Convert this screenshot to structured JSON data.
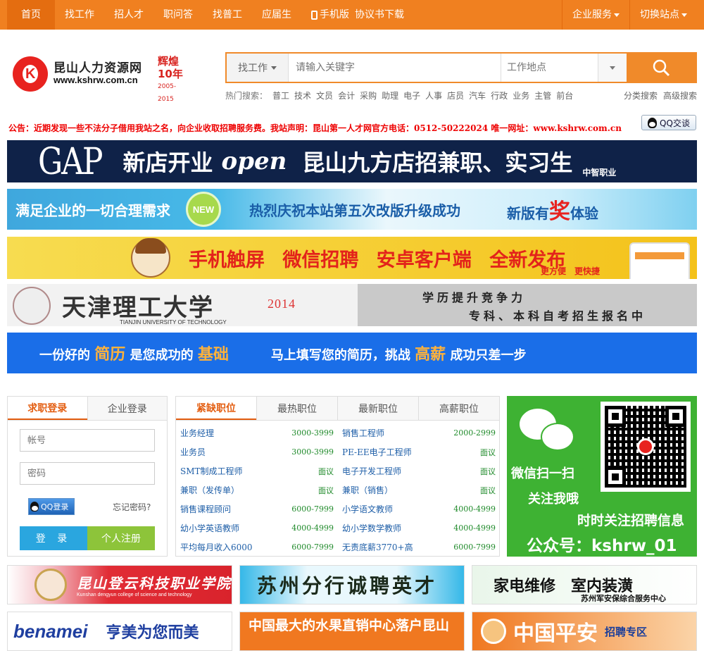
{
  "topnav": {
    "items": [
      "首页",
      "找工作",
      "招人才",
      "职问答",
      "找普工",
      "应届生"
    ],
    "mobile_label": "手机版",
    "agreement_label": "协议书下载",
    "enterprise_label": "企业服务",
    "switch_site_label": "切换站点"
  },
  "logo": {
    "name": "昆山人力资源网",
    "url": "www.kshrw.com.cn",
    "anniv_1": "辉煌",
    "anniv_2": "10年",
    "anniv_years": "2005-2015"
  },
  "search": {
    "type_label": "找工作",
    "keyword_placeholder": "请输入关键字",
    "location_placeholder": "工作地点",
    "hot_label": "热门搜索：",
    "hot_terms": [
      "普工",
      "技术",
      "文员",
      "会计",
      "采购",
      "助理",
      "电子",
      "人事",
      "店员",
      "汽车",
      "行政",
      "业务",
      "主管",
      "前台"
    ],
    "category_search": "分类搜索",
    "advanced_search": "高级搜索"
  },
  "notice": "公告：近期发现一些不法分子借用我站之名，向企业收取招聘服务费。我站声明：昆山第一人才网官方电话：0512-50222024 唯一网址：www.kshrw.com.cn",
  "qq_chat_label": "QQ交谈",
  "banners": {
    "b1": {
      "brand": "GAP",
      "t1": "新店开业",
      "t2": "open",
      "t3": "昆山九方店招兼职、实习生",
      "t4": "中智职业"
    },
    "b2": {
      "t1": "满足企业的一切合理需求",
      "new": "NEW",
      "t2": "热烈庆祝本站第五次改版升级成功",
      "t3a": "新版有",
      "t3b": "奖",
      "t3c": "体验"
    },
    "b3": {
      "t": "手机触屏 微信招聘 安卓客户端 全新发布",
      "sub": "更方便　更快捷"
    },
    "b4": {
      "name": "天津理工大学",
      "en": "TIANJIN UNIVERSITY OF TECHNOLOGY",
      "year": "2014",
      "r1": "学历提升竞争力",
      "r2": "专科、本科自考招生报名中"
    },
    "b5": {
      "t1a": "一份好的",
      "t1b": "简历",
      "t1c": "是您成功的",
      "t1d": "基础",
      "t2a": "马上填写您的简历，挑战",
      "t2b": "高薪",
      "t2c": "成功只差一步"
    }
  },
  "login": {
    "tab_job": "求职登录",
    "tab_company": "企业登录",
    "username_placeholder": "帐号",
    "password_placeholder": "密码",
    "qq_login": "QQ登录",
    "forgot": "忘记密码?",
    "login_btn": "登 录",
    "register_btn": "个人注册"
  },
  "jobs": {
    "tabs": [
      "紧缺职位",
      "最热职位",
      "最新职位",
      "高薪职位"
    ],
    "rows": [
      {
        "title": "业务经理",
        "salary": "3000-3999"
      },
      {
        "title": "销售工程师",
        "salary": "2000-2999"
      },
      {
        "title": "业务员",
        "salary": "3000-3999"
      },
      {
        "title": "PE-EE电子工程师",
        "salary": "面议"
      },
      {
        "title": "SMT制成工程师",
        "salary": "面议"
      },
      {
        "title": "电子开发工程师",
        "salary": "面议"
      },
      {
        "title": "兼职（发传单）",
        "salary": "面议"
      },
      {
        "title": "兼职（销售）",
        "salary": "面议"
      },
      {
        "title": "销售课程顾问",
        "salary": "6000-7999"
      },
      {
        "title": "小学语文教师",
        "salary": "4000-4999"
      },
      {
        "title": "幼小学英语教师",
        "salary": "4000-4999"
      },
      {
        "title": "幼小学数学教师",
        "salary": "4000-4999"
      },
      {
        "title": "平均每月收入6000",
        "salary": "6000-7999"
      },
      {
        "title": "无责底薪3770+高",
        "salary": "6000-7999"
      }
    ]
  },
  "wechat": {
    "l1": "微信扫一扫",
    "l2": "关注我哦",
    "l3": "时时关注招聘信息",
    "l4": "公众号：kshrw_01"
  },
  "ads": {
    "a1": "昆山登云科技职业学院",
    "a1_en": "Kunshan dengyun college of science and technology",
    "a2": "苏州分行诚聘英才",
    "a3": "家电维修　室内装潢",
    "a3_sub": "苏州军安保综合服务中心",
    "a4_logo": "benamei",
    "a4_t": "亨美为您而美",
    "a5": "中国最大的水果直销中心落户昆山",
    "a6": "中国平安",
    "a6_sub": "招聘专区"
  },
  "colors": {
    "accent": "#f08020",
    "link": "#1f5fa8",
    "salary": "#1f8a2a",
    "notice": "#e00000"
  }
}
